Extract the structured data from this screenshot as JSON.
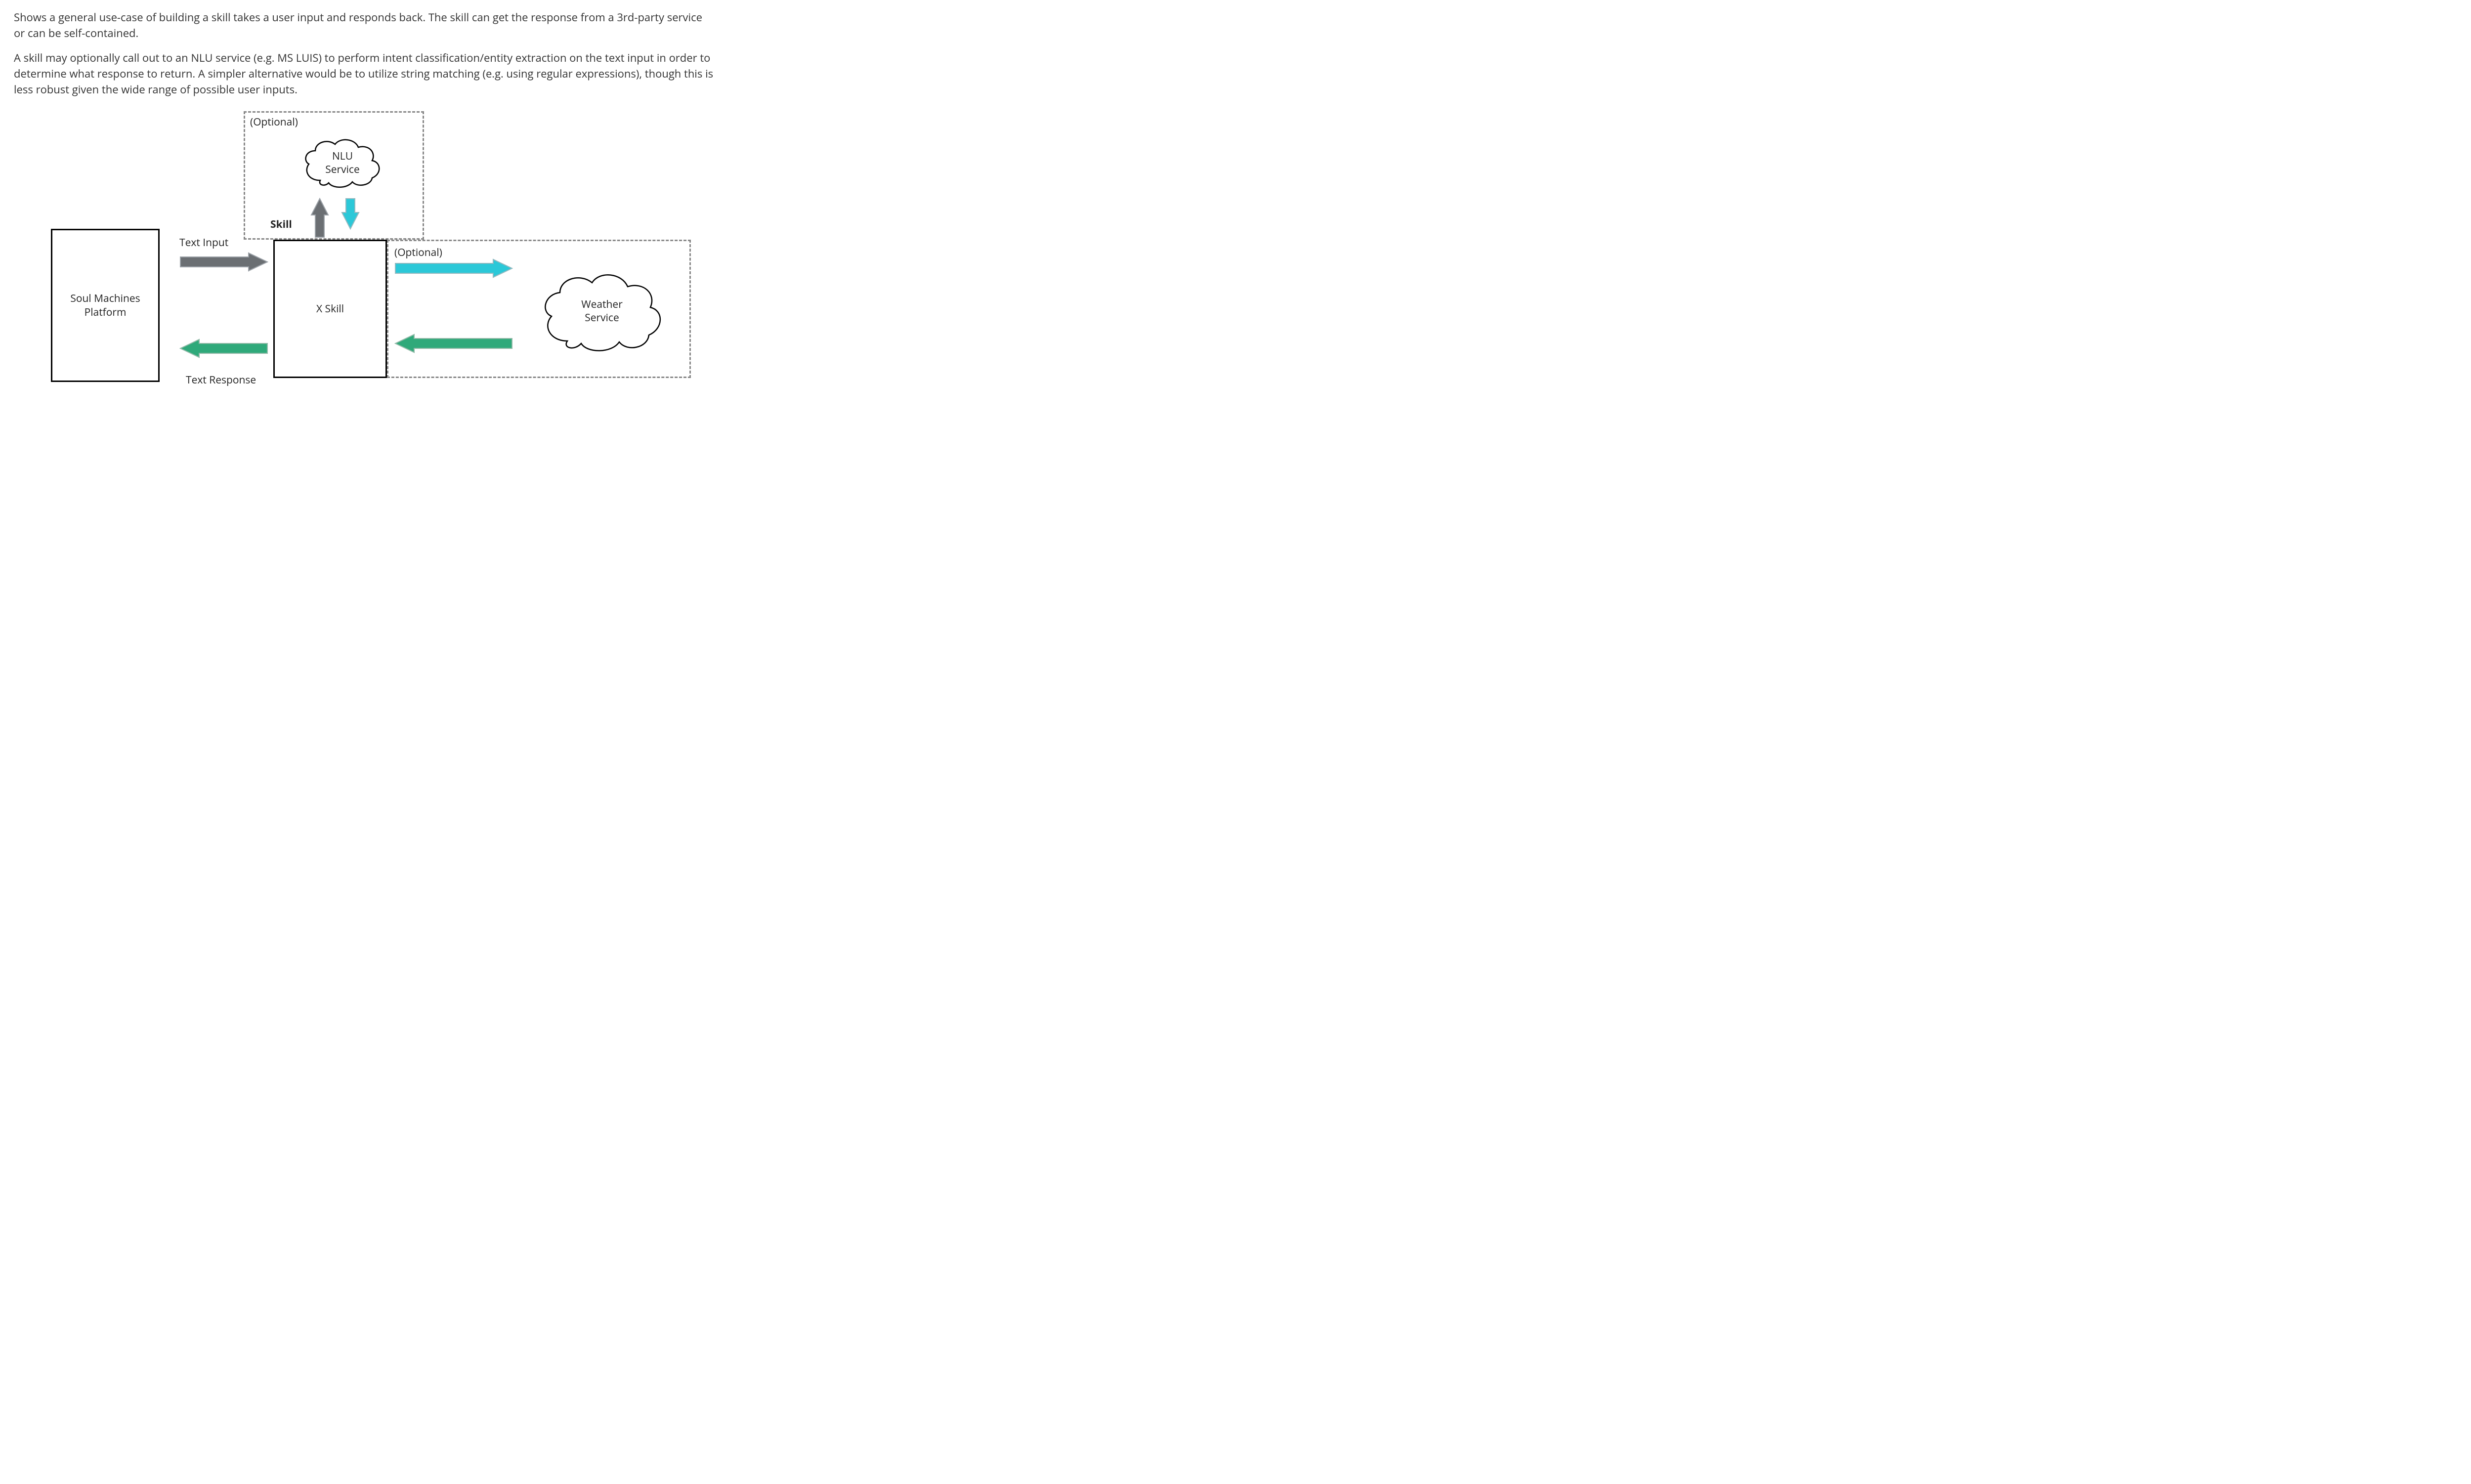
{
  "paragraphs": [
    "Shows a general use-case of building a skill takes a user input and responds back. The skill can get the response from a 3rd-party service or can be self-contained.",
    "A skill may optionally call out to an NLU service (e.g. MS LUIS) to perform intent classification/entity extraction on the text input in order to determine what response to return. A simpler alternative would be to utilize string matching (e.g. using regular expressions), though this is less robust given the wide range of possible user inputs."
  ],
  "diagram": {
    "soul_machines": {
      "line1": "Soul Machines",
      "line2": "Platform"
    },
    "x_skill": "X Skill",
    "nlu": {
      "line1": "NLU",
      "line2": "Service"
    },
    "weather": {
      "line1": "Weather",
      "line2": "Service"
    },
    "skill_label": "Skill",
    "optional_top": "(Optional)",
    "optional_right": "(Optional)",
    "text_input": "Text Input",
    "text_response": "Text Response"
  },
  "colors": {
    "gray_arrow": "#6b6f73",
    "gray_stroke": "#9aa0a6",
    "cyan_arrow": "#2bc8d8",
    "cyan_stroke": "#8fb9c0",
    "green_arrow": "#2fa97a",
    "green_stroke": "#8fb9a6",
    "dashed": "#888888"
  }
}
